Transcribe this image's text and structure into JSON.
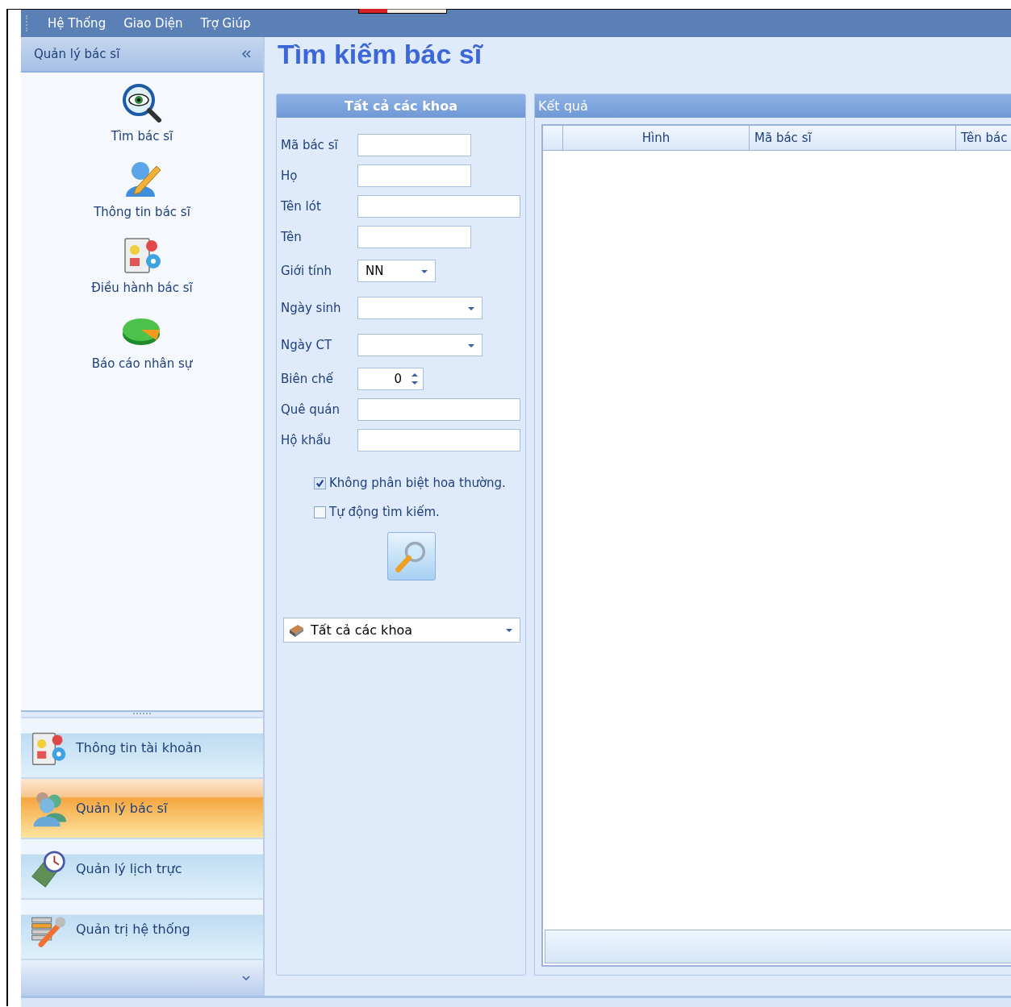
{
  "menu_bar": {
    "items": [
      "Hệ Thống",
      "Giao Diện",
      "Trợ Giúp"
    ]
  },
  "sidebar": {
    "title": "Quản lý bác sĩ",
    "items": [
      {
        "label": "Tìm bác sĩ",
        "kind": "eye"
      },
      {
        "label": "Thông tin bác sĩ",
        "kind": "pen"
      },
      {
        "label": "Điều hành bác sĩ",
        "kind": "board"
      },
      {
        "label": "Báo cáo nhân sự",
        "kind": "pie"
      }
    ],
    "nav": [
      {
        "label": "Thông tin tài khoản",
        "kind": "board",
        "selected": false
      },
      {
        "label": "Quản lý bác sĩ",
        "kind": "people",
        "selected": true
      },
      {
        "label": "Quản lý lịch trực",
        "kind": "clock",
        "selected": false
      },
      {
        "label": "Quản trị hệ thống",
        "kind": "tools",
        "selected": false
      }
    ]
  },
  "page_title": "Tìm kiếm bác sĩ",
  "search_panel": {
    "title": "Tất cả các khoa",
    "fields": [
      {
        "label": "Mã bác sĩ",
        "kind": "short"
      },
      {
        "label": "Họ",
        "kind": "short"
      },
      {
        "label": "Tên lót",
        "kind": "wide"
      },
      {
        "label": "Tên",
        "kind": "short"
      },
      {
        "label": "Giới tính",
        "kind": "select",
        "value": "NN"
      },
      {
        "label": "Ngày sinh",
        "kind": "date"
      },
      {
        "label": "Ngày CT",
        "kind": "date"
      },
      {
        "label": "Biên chế",
        "kind": "number",
        "value": "0"
      },
      {
        "label": "Quê quán",
        "kind": "wide"
      },
      {
        "label": "Hộ khẩu",
        "kind": "wide"
      }
    ],
    "options": [
      {
        "label": "Không phân biệt hoa thường.",
        "checked": true
      },
      {
        "label": "Tự động tìm kiếm.",
        "checked": false
      }
    ],
    "department": "Tất cả các khoa"
  },
  "results": {
    "title": "Kết quả",
    "columns": [
      "Hình",
      "Mã bác sĩ",
      "Tên bác"
    ]
  }
}
